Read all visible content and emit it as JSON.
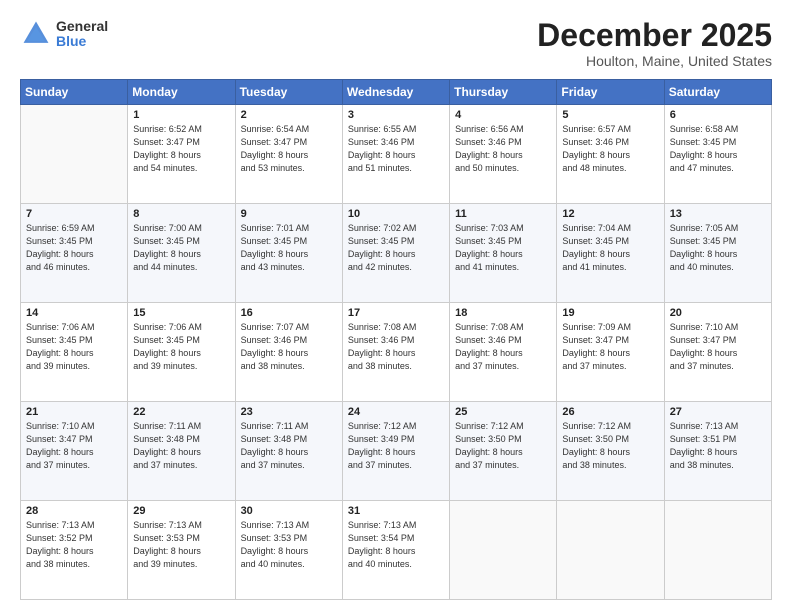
{
  "logo": {
    "general": "General",
    "blue": "Blue"
  },
  "title": "December 2025",
  "subtitle": "Houlton, Maine, United States",
  "days_header": [
    "Sunday",
    "Monday",
    "Tuesday",
    "Wednesday",
    "Thursday",
    "Friday",
    "Saturday"
  ],
  "weeks": [
    [
      {
        "day": "",
        "info": ""
      },
      {
        "day": "1",
        "info": "Sunrise: 6:52 AM\nSunset: 3:47 PM\nDaylight: 8 hours\nand 54 minutes."
      },
      {
        "day": "2",
        "info": "Sunrise: 6:54 AM\nSunset: 3:47 PM\nDaylight: 8 hours\nand 53 minutes."
      },
      {
        "day": "3",
        "info": "Sunrise: 6:55 AM\nSunset: 3:46 PM\nDaylight: 8 hours\nand 51 minutes."
      },
      {
        "day": "4",
        "info": "Sunrise: 6:56 AM\nSunset: 3:46 PM\nDaylight: 8 hours\nand 50 minutes."
      },
      {
        "day": "5",
        "info": "Sunrise: 6:57 AM\nSunset: 3:46 PM\nDaylight: 8 hours\nand 48 minutes."
      },
      {
        "day": "6",
        "info": "Sunrise: 6:58 AM\nSunset: 3:45 PM\nDaylight: 8 hours\nand 47 minutes."
      }
    ],
    [
      {
        "day": "7",
        "info": "Sunrise: 6:59 AM\nSunset: 3:45 PM\nDaylight: 8 hours\nand 46 minutes."
      },
      {
        "day": "8",
        "info": "Sunrise: 7:00 AM\nSunset: 3:45 PM\nDaylight: 8 hours\nand 44 minutes."
      },
      {
        "day": "9",
        "info": "Sunrise: 7:01 AM\nSunset: 3:45 PM\nDaylight: 8 hours\nand 43 minutes."
      },
      {
        "day": "10",
        "info": "Sunrise: 7:02 AM\nSunset: 3:45 PM\nDaylight: 8 hours\nand 42 minutes."
      },
      {
        "day": "11",
        "info": "Sunrise: 7:03 AM\nSunset: 3:45 PM\nDaylight: 8 hours\nand 41 minutes."
      },
      {
        "day": "12",
        "info": "Sunrise: 7:04 AM\nSunset: 3:45 PM\nDaylight: 8 hours\nand 41 minutes."
      },
      {
        "day": "13",
        "info": "Sunrise: 7:05 AM\nSunset: 3:45 PM\nDaylight: 8 hours\nand 40 minutes."
      }
    ],
    [
      {
        "day": "14",
        "info": "Sunrise: 7:06 AM\nSunset: 3:45 PM\nDaylight: 8 hours\nand 39 minutes."
      },
      {
        "day": "15",
        "info": "Sunrise: 7:06 AM\nSunset: 3:45 PM\nDaylight: 8 hours\nand 39 minutes."
      },
      {
        "day": "16",
        "info": "Sunrise: 7:07 AM\nSunset: 3:46 PM\nDaylight: 8 hours\nand 38 minutes."
      },
      {
        "day": "17",
        "info": "Sunrise: 7:08 AM\nSunset: 3:46 PM\nDaylight: 8 hours\nand 38 minutes."
      },
      {
        "day": "18",
        "info": "Sunrise: 7:08 AM\nSunset: 3:46 PM\nDaylight: 8 hours\nand 37 minutes."
      },
      {
        "day": "19",
        "info": "Sunrise: 7:09 AM\nSunset: 3:47 PM\nDaylight: 8 hours\nand 37 minutes."
      },
      {
        "day": "20",
        "info": "Sunrise: 7:10 AM\nSunset: 3:47 PM\nDaylight: 8 hours\nand 37 minutes."
      }
    ],
    [
      {
        "day": "21",
        "info": "Sunrise: 7:10 AM\nSunset: 3:47 PM\nDaylight: 8 hours\nand 37 minutes."
      },
      {
        "day": "22",
        "info": "Sunrise: 7:11 AM\nSunset: 3:48 PM\nDaylight: 8 hours\nand 37 minutes."
      },
      {
        "day": "23",
        "info": "Sunrise: 7:11 AM\nSunset: 3:48 PM\nDaylight: 8 hours\nand 37 minutes."
      },
      {
        "day": "24",
        "info": "Sunrise: 7:12 AM\nSunset: 3:49 PM\nDaylight: 8 hours\nand 37 minutes."
      },
      {
        "day": "25",
        "info": "Sunrise: 7:12 AM\nSunset: 3:50 PM\nDaylight: 8 hours\nand 37 minutes."
      },
      {
        "day": "26",
        "info": "Sunrise: 7:12 AM\nSunset: 3:50 PM\nDaylight: 8 hours\nand 38 minutes."
      },
      {
        "day": "27",
        "info": "Sunrise: 7:13 AM\nSunset: 3:51 PM\nDaylight: 8 hours\nand 38 minutes."
      }
    ],
    [
      {
        "day": "28",
        "info": "Sunrise: 7:13 AM\nSunset: 3:52 PM\nDaylight: 8 hours\nand 38 minutes."
      },
      {
        "day": "29",
        "info": "Sunrise: 7:13 AM\nSunset: 3:53 PM\nDaylight: 8 hours\nand 39 minutes."
      },
      {
        "day": "30",
        "info": "Sunrise: 7:13 AM\nSunset: 3:53 PM\nDaylight: 8 hours\nand 40 minutes."
      },
      {
        "day": "31",
        "info": "Sunrise: 7:13 AM\nSunset: 3:54 PM\nDaylight: 8 hours\nand 40 minutes."
      },
      {
        "day": "",
        "info": ""
      },
      {
        "day": "",
        "info": ""
      },
      {
        "day": "",
        "info": ""
      }
    ]
  ]
}
